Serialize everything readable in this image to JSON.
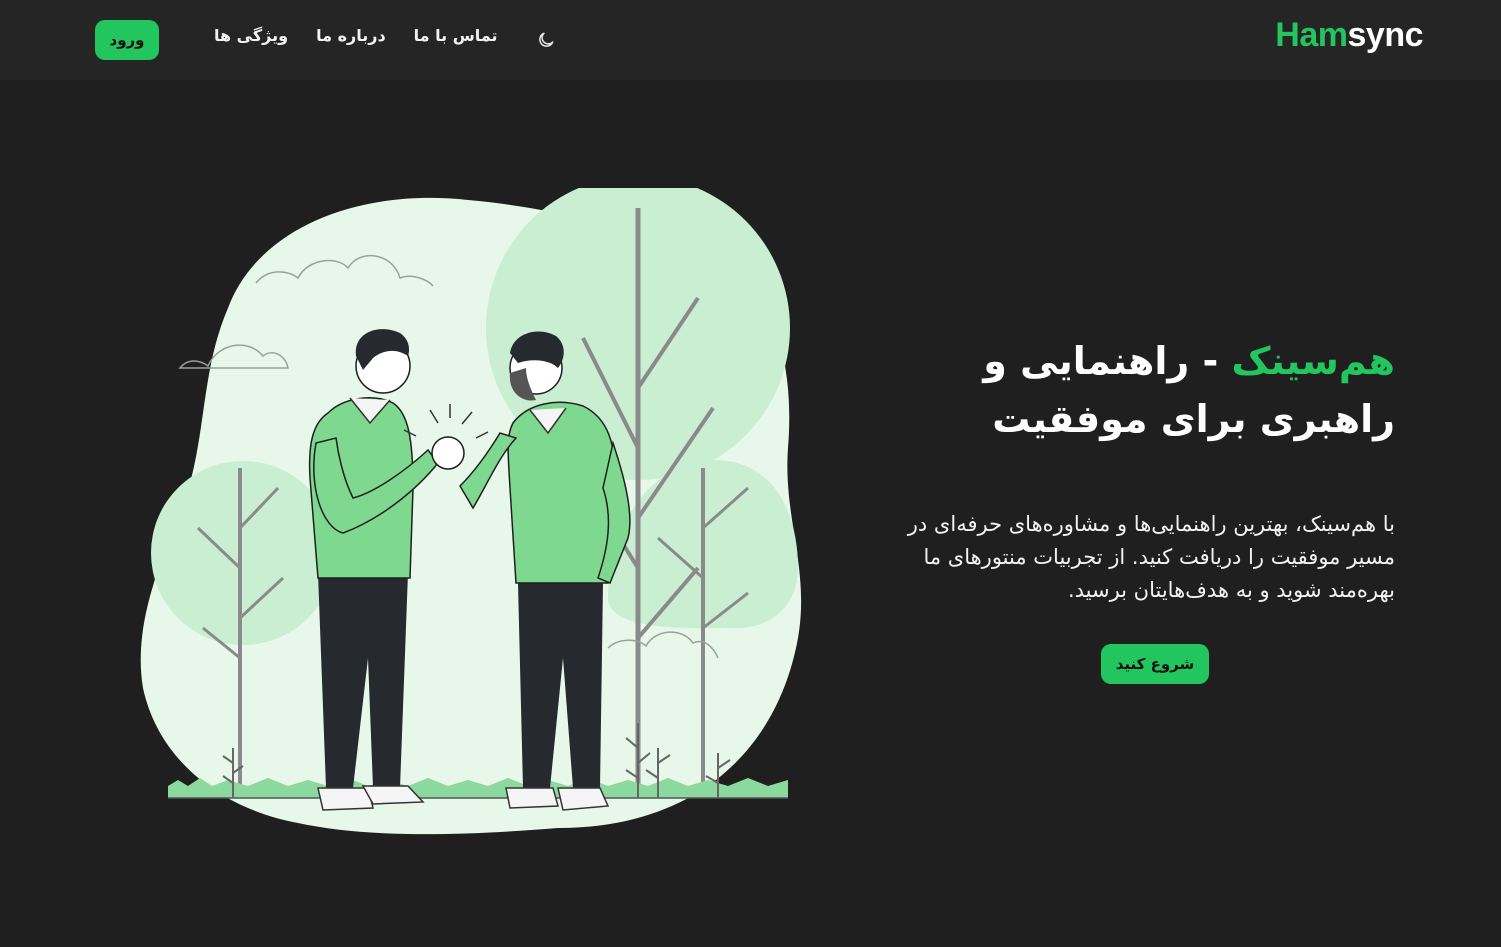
{
  "brand": {
    "logo_part1": "Ham",
    "logo_part2": "sync"
  },
  "nav": {
    "links": [
      "ویژگی ها",
      "درباره ما",
      "تماس با ما"
    ],
    "theme_toggle_icon": "moon-icon",
    "login_label": "ورود"
  },
  "hero": {
    "title_accent": "هم‌سینک",
    "title_rest": " - راهنمایی و راهبری برای موفقیت",
    "description": "با هم‌سینک، بهترین راهنمایی‌ها و مشاوره‌های حرفه‌ای در مسیر موفقیت را دریافت کنید. از تجربیات منتورهای ما بهره‌مند شوید و به هدف‌هایتان برسید.",
    "cta_label": "شروع کنید",
    "illustration": "two-men-handshake-illustration"
  },
  "colors": {
    "background": "#1f1f1f",
    "navbar": "#252525",
    "accent": "#22c55e",
    "text": "#ffffff"
  }
}
